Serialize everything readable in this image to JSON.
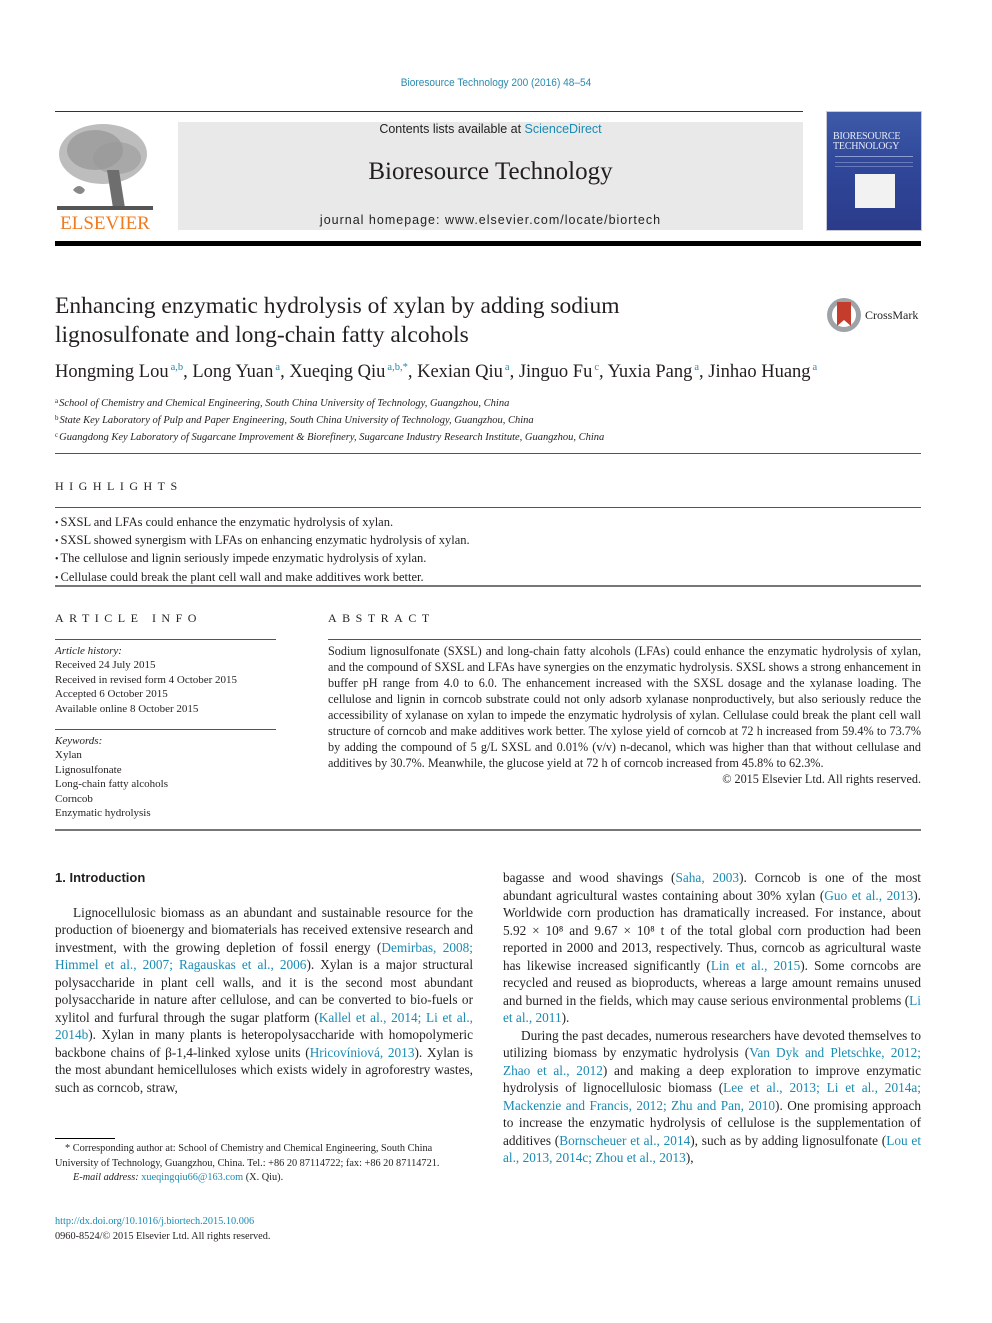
{
  "header": {
    "citation": "Bioresource Technology 200 (2016) 48–54",
    "contents_prefix": "Contents lists available at ",
    "contents_link": "ScienceDirect",
    "journal_title": "Bioresource Technology",
    "homepage": "journal homepage: www.elsevier.com/locate/biortech",
    "publisher_logo_text": "ELSEVIER",
    "cover_title_line1": "BIORESOURCE",
    "cover_title_line2": "TECHNOLOGY",
    "colors": {
      "link": "#1a8bb3",
      "elsevier_orange": "#f07a1f",
      "masthead_bg": "#e9e9e9"
    }
  },
  "article": {
    "title": "Enhancing enzymatic hydrolysis of xylan by adding sodium lignosulfonate and long-chain fatty alcohols",
    "crossmark_label": "CrossMark",
    "authors": [
      {
        "name": "Hongming Lou",
        "sup": "a,b",
        "sep": ", "
      },
      {
        "name": "Long Yuan",
        "sup": "a",
        "sep": ", "
      },
      {
        "name": "Xueqing Qiu",
        "sup": "a,b,*",
        "sep": ", "
      },
      {
        "name": "Kexian Qiu",
        "sup": "a",
        "sep": ", "
      },
      {
        "name": "Jinguo Fu",
        "sup": "c",
        "sep": ", "
      },
      {
        "name": "Yuxia Pang",
        "sup": "a",
        "sep": ", "
      },
      {
        "name": "Jinhao Huang",
        "sup": "a",
        "sep": ""
      }
    ],
    "affiliations": [
      {
        "key": "a",
        "text": "School of Chemistry and Chemical Engineering, South China University of Technology, Guangzhou, China"
      },
      {
        "key": "b",
        "text": "State Key Laboratory of Pulp and Paper Engineering, South China University of Technology, Guangzhou, China"
      },
      {
        "key": "c",
        "text": "Guangdong Key Laboratory of Sugarcane Improvement & Biorefinery, Sugarcane Industry Research Institute, Guangzhou, China"
      }
    ]
  },
  "highlights": {
    "label": "HIGHLIGHTS",
    "items": [
      "SXSL and LFAs could enhance the enzymatic hydrolysis of xylan.",
      "SXSL showed synergism with LFAs on enhancing enzymatic hydrolysis of xylan.",
      "The cellulose and lignin seriously impede enzymatic hydrolysis of xylan.",
      "Cellulase could break the plant cell wall and make additives work better."
    ]
  },
  "article_info": {
    "label": "ARTICLE INFO",
    "history_label": "Article history:",
    "history": [
      "Received 24 July 2015",
      "Received in revised form 4 October 2015",
      "Accepted 6 October 2015",
      "Available online 8 October 2015"
    ],
    "keywords_label": "Keywords:",
    "keywords": [
      "Xylan",
      "Lignosulfonate",
      "Long-chain fatty alcohols",
      "Corncob",
      "Enzymatic hydrolysis"
    ]
  },
  "abstract": {
    "label": "ABSTRACT",
    "text": "Sodium lignosulfonate (SXSL) and long-chain fatty alcohols (LFAs) could enhance the enzymatic hydrolysis of xylan, and the compound of SXSL and LFAs have synergies on the enzymatic hydrolysis. SXSL shows a strong enhancement in buffer pH range from 4.0 to 6.0. The enhancement increased with the SXSL dosage and the xylanase loading. The cellulose and lignin in corncob substrate could not only adsorb xylanase nonproductively, but also seriously reduce the accessibility of xylanase on xylan to impede the enzymatic hydrolysis of xylan. Cellulase could break the plant cell wall structure of corncob and make additives work better. The xylose yield of corncob at 72 h increased from 59.4% to 73.7% by adding the compound of 5 g/L SXSL and 0.01% (v/v) n-decanol, which was higher than that without cellulase and additives by 30.7%. Meanwhile, the glucose yield at 72 h of corncob increased from 45.8% to 62.3%.",
    "copyright": "© 2015 Elsevier Ltd. All rights reserved."
  },
  "body": {
    "section_heading": "1. Introduction",
    "left_paragraph": [
      {
        "t": "Lignocellulosic biomass as an abundant and sustainable resource for the production of bioenergy and biomaterials has received extensive research and investment, with the growing depletion of fossil energy ("
      },
      {
        "l": "Demirbas, 2008; Himmel et al., 2007; Ragauskas et al., 2006"
      },
      {
        "t": "). Xylan is a major structural polysaccharide in plant cell walls, and it is the second most abundant polysaccharide in nature after cellulose, and can be converted to bio-fuels or xylitol and furfural through the sugar platform ("
      },
      {
        "l": "Kallel et al., 2014; Li et al., 2014b"
      },
      {
        "t": "). Xylan in many plants is heteropolysaccharide with homopolymeric backbone chains of β-1,4-linked xylose units ("
      },
      {
        "l": "Hricovíniová, 2013"
      },
      {
        "t": "). Xylan is the most abundant hemicelluloses which exists widely in agroforestry wastes, such as corncob, straw,"
      }
    ],
    "right_paragraph_1": [
      {
        "t": "bagasse and wood shavings ("
      },
      {
        "l": "Saha, 2003"
      },
      {
        "t": "). Corncob is one of the most abundant agricultural wastes containing about 30% xylan ("
      },
      {
        "l": "Guo et al., 2013"
      },
      {
        "t": "). Worldwide corn production has dramatically increased. For instance, about 5.92 × 10⁸ and 9.67 × 10⁸ t of the total global corn production had been reported in 2000 and 2013, respectively. Thus, corncob as agricultural waste has likewise increased significantly ("
      },
      {
        "l": "Lin et al., 2015"
      },
      {
        "t": "). Some corncobs are recycled and reused as bioproducts, whereas a large amount remains unused and burned in the fields, which may cause serious environmental problems ("
      },
      {
        "l": "Li et al., 2011"
      },
      {
        "t": ")."
      }
    ],
    "right_paragraph_2": [
      {
        "t": "During the past decades, numerous researchers have devoted themselves to utilizing biomass by enzymatic hydrolysis ("
      },
      {
        "l": "Van Dyk and Pletschke, 2012; Zhao et al., 2012"
      },
      {
        "t": ") and making a deep exploration to improve enzymatic hydrolysis of lignocellulosic biomass ("
      },
      {
        "l": "Lee et al., 2013; Li et al., 2014a; Mackenzie and Francis, 2012; Zhu and Pan, 2010"
      },
      {
        "t": "). One promising approach to increase the enzymatic hydrolysis of cellulose is the supplementation of additives ("
      },
      {
        "l": "Bornscheuer et al., 2014"
      },
      {
        "t": "), such as by adding lignosulfonate ("
      },
      {
        "l": "Lou et al., 2013, 2014c; Zhou et al., 2013"
      },
      {
        "t": "),"
      }
    ]
  },
  "footnote": {
    "corresponding": "* Corresponding author at: School of Chemistry and Chemical Engineering, South China University of Technology, Guangzhou, China. Tel.: +86 20 87114722; fax: +86 20 87114721.",
    "email_label": "E-mail address: ",
    "email": "xueqingqiu66@163.com",
    "email_suffix": " (X. Qiu).",
    "doi": "http://dx.doi.org/10.1016/j.biortech.2015.10.006",
    "issn": "0960-8524/© 2015 Elsevier Ltd. All rights reserved."
  }
}
